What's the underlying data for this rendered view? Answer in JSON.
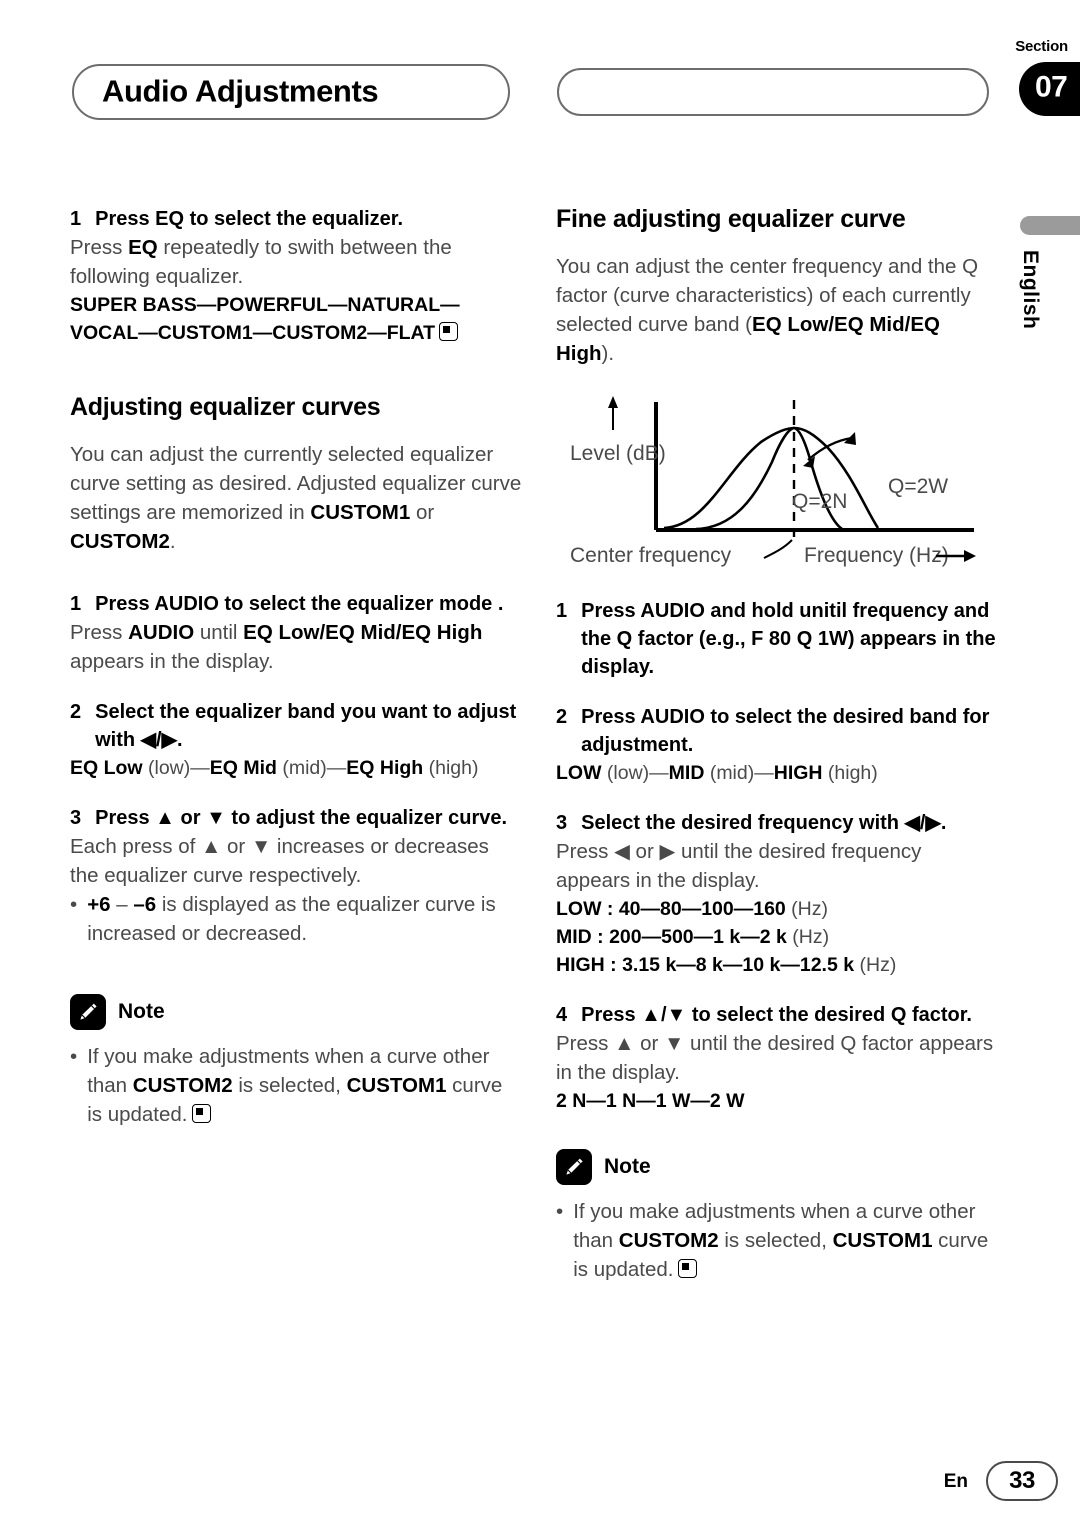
{
  "header": {
    "title": "Audio Adjustments",
    "section_label": "Section",
    "section_number": "07"
  },
  "side_tab": {
    "language": "English"
  },
  "left_column": {
    "step1": {
      "num": "1",
      "text": "Press EQ to select the equalizer.",
      "body_prefix": "Press ",
      "body_bold": "EQ",
      "body_suffix": " repeatedly to swith between the following equalizer."
    },
    "equalizer_chain": "SUPER BASS—POWERFUL—NATURAL—VOCAL—CUSTOM1—CUSTOM2—FLAT",
    "heading": "Adjusting equalizer curves",
    "intro_a": "You can adjust the currently selected equalizer curve setting as desired. Adjusted equalizer curve settings are memorized in ",
    "intro_bold1": "CUSTOM1",
    "intro_b": " or ",
    "intro_bold2": "CUSTOM2",
    "intro_c": ".",
    "steps": [
      {
        "num": "1",
        "title": "Press AUDIO to select the  equalizer mode .",
        "body_a": "Press ",
        "body_bold1": "AUDIO",
        "body_b": " until ",
        "body_bold2": "EQ Low/EQ Mid/EQ High",
        "body_c": " appears in the display."
      },
      {
        "num": "2",
        "title": "Select the equalizer band you want to adjust with ◀/▶.",
        "chain_bold1": "EQ Low",
        "chain_lite1": " (low)—",
        "chain_bold2": "EQ Mid",
        "chain_lite2": " (mid)—",
        "chain_bold3": "EQ High",
        "chain_lite3": " (high)"
      },
      {
        "num": "3",
        "title": "Press ▲ or ▼ to adjust the equalizer curve.",
        "body": "Each press of ▲ or ▼ increases or decreases the equalizer curve respectively.",
        "bullet_bold1": "+6",
        "bullet_mid": " – ",
        "bullet_bold2": "–6",
        "bullet_rest": " is displayed as the equalizer curve is increased or decreased."
      }
    ],
    "note": {
      "title": "Note",
      "bullet_a": "If you make adjustments when a curve other than ",
      "bullet_bold1": "CUSTOM2",
      "bullet_b": " is selected, ",
      "bullet_bold2": "CUSTOM1",
      "bullet_c": " curve is updated."
    }
  },
  "right_column": {
    "heading": "Fine adjusting equalizer curve",
    "intro_a": "You can adjust the center frequency and the Q factor (curve characteristics) of each currently selected curve band (",
    "intro_bold": "EQ Low/EQ Mid/EQ High",
    "intro_b": ").",
    "steps": [
      {
        "num": "1",
        "title": "Press AUDIO and hold unitil frequency and the Q factor (e.g., F 80 Q 1W) appears in the display."
      },
      {
        "num": "2",
        "title": "Press AUDIO to select the desired band for adjustment.",
        "chain_bold1": "LOW",
        "chain_lite1": " (low)—",
        "chain_bold2": "MID",
        "chain_lite2": " (mid)—",
        "chain_bold3": "HIGH",
        "chain_lite3": " (high)"
      },
      {
        "num": "3",
        "title": "Select the desired frequency with ◀/▶.",
        "body": "Press ◀ or ▶ until the desired frequency appears in the display.",
        "freq_rows": [
          {
            "band": "LOW : 40—80—100—160",
            "unit": " (Hz)"
          },
          {
            "band": "MID : 200—500—1 k—2 k",
            "unit": " (Hz)"
          },
          {
            "band": "HIGH : 3.15 k—8 k—10 k—12.5 k",
            "unit": " (Hz)"
          }
        ]
      },
      {
        "num": "4",
        "title": "Press ▲/▼ to select the desired Q factor.",
        "body": "Press ▲ or ▼ until the desired Q factor appears in the display.",
        "q_values": "2 N—1 N—1 W—2 W"
      }
    ],
    "note": {
      "title": "Note",
      "bullet_a": "If you make adjustments when a curve other than ",
      "bullet_bold1": "CUSTOM2",
      "bullet_b": " is selected, ",
      "bullet_bold2": "CUSTOM1",
      "bullet_c": " curve is updated."
    }
  },
  "chart_data": {
    "type": "line",
    "title": "",
    "xlabel": "Frequency (Hz)",
    "ylabel": "Level (dB)",
    "annotations": [
      {
        "text": "Center frequency",
        "target": "dashed vertical line at curve peak"
      },
      {
        "text": "Q=2N",
        "target": "narrow bell curve"
      },
      {
        "text": "Q=2W",
        "target": "wide bell curve"
      }
    ],
    "series": [
      {
        "name": "Q=2W",
        "description": "wide bell curve peaking at center frequency"
      },
      {
        "name": "Q=2N",
        "description": "narrow bell curve peaking at center frequency"
      }
    ],
    "grid": false,
    "legend": "none"
  },
  "footer": {
    "locale": "En",
    "page": "33"
  }
}
